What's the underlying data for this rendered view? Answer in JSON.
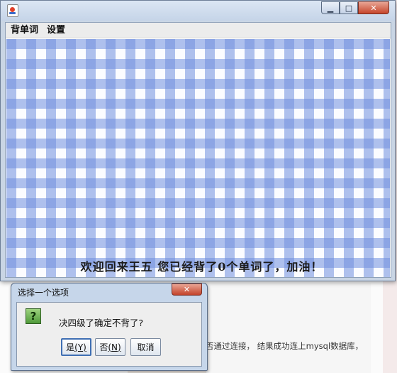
{
  "background": {
    "article_text": "否通过连接， 结果成功连上mysql数据库，"
  },
  "window": {
    "minimize_glyph": "▁",
    "maximize_glyph": "□",
    "close_glyph": "✕",
    "menu": [
      "背单词",
      "设置"
    ],
    "welcome_message": "欢迎回来王五  您已经背了0个单词了，加油！",
    "pattern_colors": {
      "check": "#708ede",
      "base": "#fbfcff"
    }
  },
  "dialog": {
    "title": "选择一个选项",
    "close_glyph": "✕",
    "icon_glyph": "?",
    "message": "决四级了确定不背了?",
    "buttons": {
      "yes_text": "是",
      "yes_mnemonic": "(Y)",
      "no_text": "否",
      "no_mnemonic": "(N)",
      "cancel": "取消"
    }
  }
}
